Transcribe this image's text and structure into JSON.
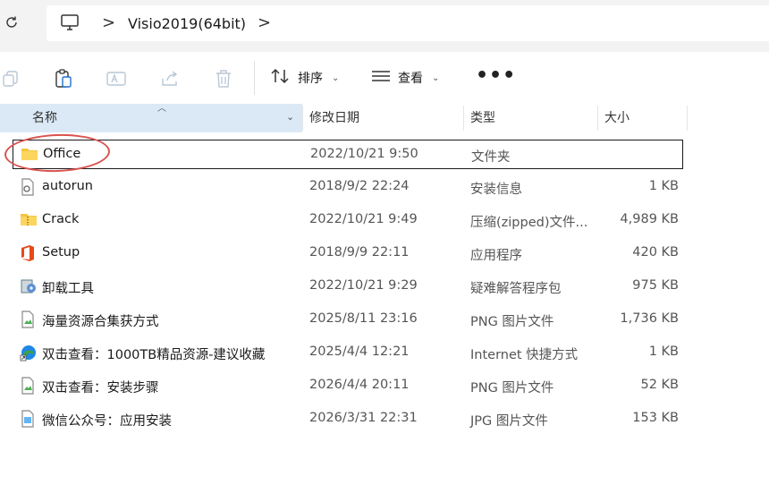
{
  "address": {
    "path_segment": "Visio2019(64bit)",
    "separator": ">"
  },
  "toolbar": {
    "sort_label": "排序",
    "view_label": "查看",
    "more_label": "•••"
  },
  "columns": {
    "name": "名称",
    "modified": "修改日期",
    "type": "类型",
    "size": "大小"
  },
  "files": [
    {
      "name": "Office",
      "date": "2022/10/21 9:50",
      "type": "文件夹",
      "size": "",
      "icon": "folder-icon"
    },
    {
      "name": "autorun",
      "date": "2018/9/2 22:24",
      "type": "安装信息",
      "size": "1 KB",
      "icon": "setup-info-icon"
    },
    {
      "name": "Crack",
      "date": "2022/10/21 9:49",
      "type": "压缩(zipped)文件...",
      "size": "4,989 KB",
      "icon": "zip-folder-icon"
    },
    {
      "name": "Setup",
      "date": "2018/9/9 22:11",
      "type": "应用程序",
      "size": "420 KB",
      "icon": "office-icon"
    },
    {
      "name": "卸载工具",
      "date": "2022/10/21 9:29",
      "type": "疑难解答程序包",
      "size": "975 KB",
      "icon": "troubleshooter-icon"
    },
    {
      "name": "海量资源合集获方式",
      "date": "2025/8/11 23:16",
      "type": "PNG 图片文件",
      "size": "1,736 KB",
      "icon": "png-file-icon"
    },
    {
      "name": "双击查看：1000TB精品资源-建议收藏",
      "date": "2025/4/4 12:21",
      "type": "Internet 快捷方式",
      "size": "1 KB",
      "icon": "edge-shortcut-icon"
    },
    {
      "name": "双击查看：安装步骤",
      "date": "2026/4/4 20:11",
      "type": "PNG 图片文件",
      "size": "52 KB",
      "icon": "png-file-icon"
    },
    {
      "name": "微信公众号：应用安装",
      "date": "2026/3/31 22:31",
      "type": "JPG 图片文件",
      "size": "153 KB",
      "icon": "jpg-file-icon"
    }
  ],
  "colors": {
    "header_highlight": "#dbe9f6",
    "annotation": "#d9534f",
    "folder": "#f4c542"
  }
}
